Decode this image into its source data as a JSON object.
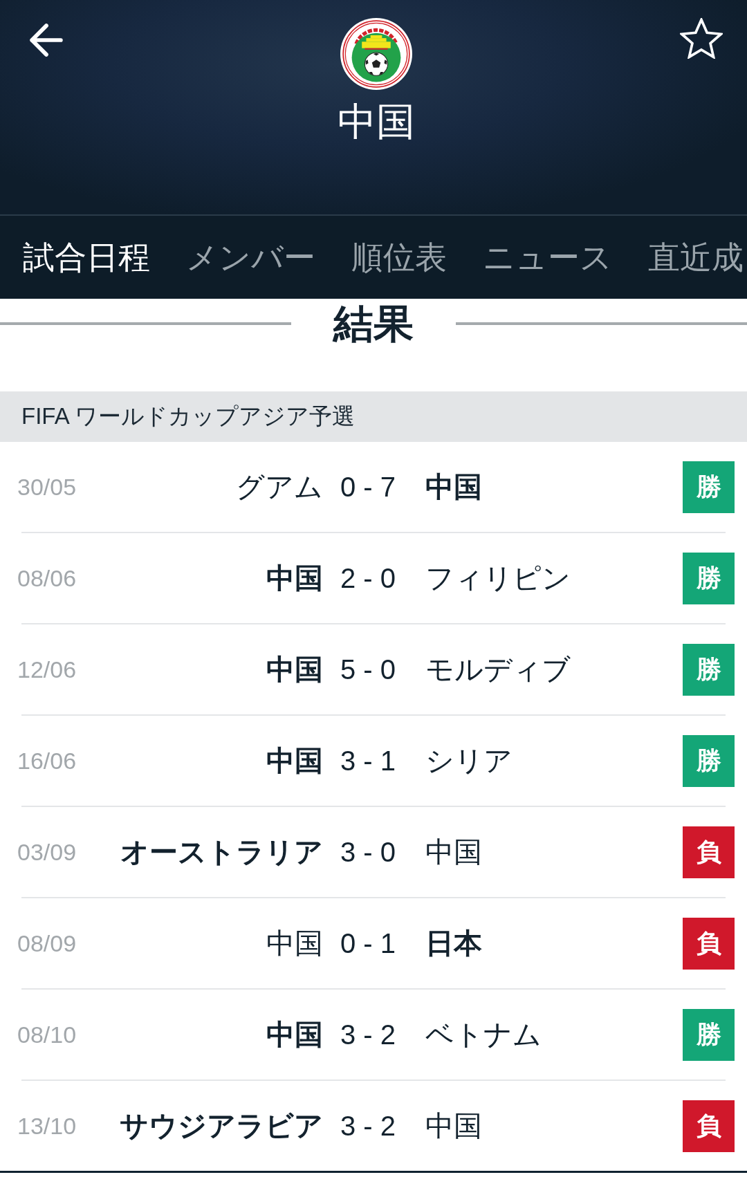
{
  "header": {
    "title": "中国"
  },
  "tabs": [
    {
      "label": "試合日程",
      "selected": true
    },
    {
      "label": "メンバー",
      "selected": false
    },
    {
      "label": "順位表",
      "selected": false
    },
    {
      "label": "ニュース",
      "selected": false
    },
    {
      "label": "直近成",
      "selected": false
    }
  ],
  "section": {
    "title": "結果"
  },
  "competitions": [
    {
      "name": "FIFA ワールドカップアジア予選",
      "matches": [
        {
          "date": "30/05",
          "home": "グアム",
          "home_winner": false,
          "score": "0 - 7",
          "away": "中国",
          "away_winner": true,
          "result": {
            "label": "勝",
            "color": "#14a677"
          }
        },
        {
          "date": "08/06",
          "home": "中国",
          "home_winner": true,
          "score": "2 - 0",
          "away": "フィリピン",
          "away_winner": false,
          "result": {
            "label": "勝",
            "color": "#14a677"
          }
        },
        {
          "date": "12/06",
          "home": "中国",
          "home_winner": true,
          "score": "5 - 0",
          "away": "モルディブ",
          "away_winner": false,
          "result": {
            "label": "勝",
            "color": "#14a677"
          }
        },
        {
          "date": "16/06",
          "home": "中国",
          "home_winner": true,
          "score": "3 - 1",
          "away": "シリア",
          "away_winner": false,
          "result": {
            "label": "勝",
            "color": "#14a677"
          }
        },
        {
          "date": "03/09",
          "home": "オーストラリア",
          "home_winner": true,
          "score": "3 - 0",
          "away": "中国",
          "away_winner": false,
          "result": {
            "label": "負",
            "color": "#d0182b"
          }
        },
        {
          "date": "08/09",
          "home": "中国",
          "home_winner": false,
          "score": "0 - 1",
          "away": "日本",
          "away_winner": true,
          "result": {
            "label": "負",
            "color": "#d0182b"
          }
        },
        {
          "date": "08/10",
          "home": "中国",
          "home_winner": true,
          "score": "3 - 2",
          "away": "ベトナム",
          "away_winner": false,
          "result": {
            "label": "勝",
            "color": "#14a677"
          }
        },
        {
          "date": "13/10",
          "home": "サウジアラビア",
          "home_winner": true,
          "score": "3 - 2",
          "away": "中国",
          "away_winner": false,
          "result": {
            "label": "負",
            "color": "#d0182b"
          }
        }
      ]
    }
  ]
}
